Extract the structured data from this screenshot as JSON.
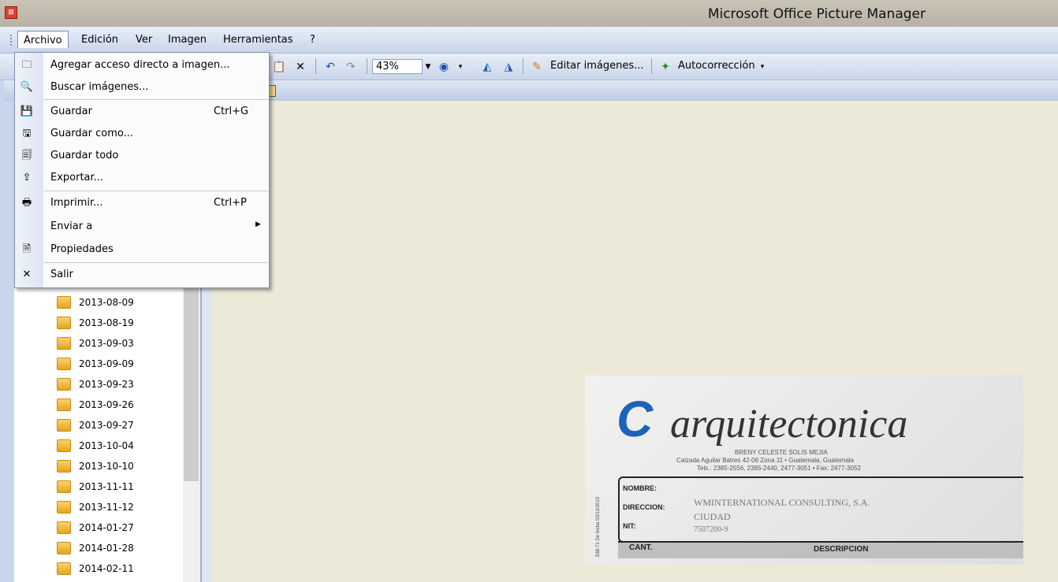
{
  "window": {
    "title": "Microsoft Office Picture Manager"
  },
  "menubar": {
    "items": [
      "Archivo",
      "Edición",
      "Ver",
      "Imagen",
      "Herramientas",
      "?"
    ]
  },
  "toolbar": {
    "zoom": "43%",
    "edit_images": "Editar imágenes...",
    "autocorrect": "Autocorrección"
  },
  "file_menu": {
    "items": [
      {
        "label": "Agregar acceso directo a imagen...",
        "shortcut": "",
        "icon": "add-shortcut-icon"
      },
      {
        "label": "Buscar imágenes...",
        "shortcut": "",
        "icon": "search-images-icon"
      },
      {
        "label": "Guardar",
        "shortcut": "Ctrl+G",
        "icon": "save-icon"
      },
      {
        "label": "Guardar como...",
        "shortcut": "",
        "icon": "save-as-icon"
      },
      {
        "label": "Guardar todo",
        "shortcut": "",
        "icon": "save-all-icon"
      },
      {
        "label": "Exportar...",
        "shortcut": "",
        "icon": "export-icon"
      },
      {
        "label": "Imprimir...",
        "shortcut": "Ctrl+P",
        "icon": "print-icon"
      },
      {
        "label": "Enviar a",
        "shortcut": "",
        "icon": ""
      },
      {
        "label": "Propiedades",
        "shortcut": "",
        "icon": "properties-icon"
      },
      {
        "label": "Salir",
        "shortcut": "",
        "icon": "close-icon"
      }
    ]
  },
  "folders": [
    "2013-08-09",
    "2013-08-19",
    "2013-09-03",
    "2013-09-09",
    "2013-09-23",
    "2013-09-26",
    "2013-09-27",
    "2013-10-04",
    "2013-10-10",
    "2013-11-11",
    "2013-11-12",
    "2014-01-27",
    "2014-01-28",
    "2014-02-11"
  ],
  "preview": {
    "brand": "arquitectonica",
    "owner": "BRENY CELESTE SOLIS MEJIA",
    "address": "Calzada Aguilar Batres 42-06 Zona 11 • Guatemala, Guatemala",
    "phones": "Tels.: 2385-2556, 2385-2440, 2477-3051 • Fax: 2477-3052",
    "nombre_label": "NOMBRE:",
    "direccion_label": "DIRECCION:",
    "nit_label": "NIT:",
    "nombre_value": "WMINTERNATIONAL CONSULTING, S.A.",
    "direccion_value": "CIUDAD",
    "nit_value": "7507200-9",
    "col_cant": "CANT.",
    "col_desc": "DESCRIPCION",
    "side_text": "538-71  De fecha 03/12/2010"
  }
}
